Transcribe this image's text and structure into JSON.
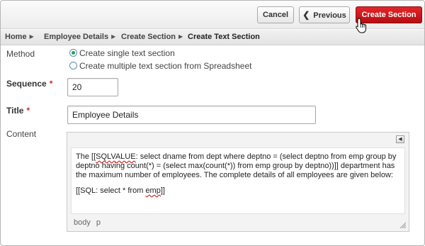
{
  "toolbar": {
    "cancel_label": "Cancel",
    "previous_label": "Previous",
    "create_label": "Create Section"
  },
  "breadcrumb": {
    "items": [
      "Home",
      "Employee Details",
      "Create Section",
      "Create Text Section"
    ]
  },
  "form": {
    "method_label": "Method",
    "method_options": [
      "Create single text section",
      "Create multiple text section from Spreadsheet"
    ],
    "method_selected_index": 0,
    "sequence_label": "Sequence",
    "sequence_value": "20",
    "title_label": "Title",
    "title_value": "Employee Details",
    "content_label": "Content"
  },
  "editor": {
    "para1_a": "The [[",
    "para1_sql": "SQLVALUE",
    "para1_b": ": select dname from dept where deptno = (select deptno from emp group by deptno having count(*) = (select max(count(*)) from emp group by deptno))]] department has the maximum number of employees. The complete details of all employees are given below:",
    "para2_a": "[[SQL: select * from ",
    "para2_emp": "emp",
    "para2_b": "]]",
    "status_path": [
      "body",
      "p"
    ]
  },
  "icons": {
    "previous": "chevron-left-icon",
    "toolbar_toggle": "triangle-left-icon",
    "resize": "resize-grip-icon",
    "cursor": "hand-pointer-icon"
  },
  "colors": {
    "primary_button": "#c8151a",
    "required": "#dd2222",
    "radio_selected": "#2e9e4d"
  }
}
